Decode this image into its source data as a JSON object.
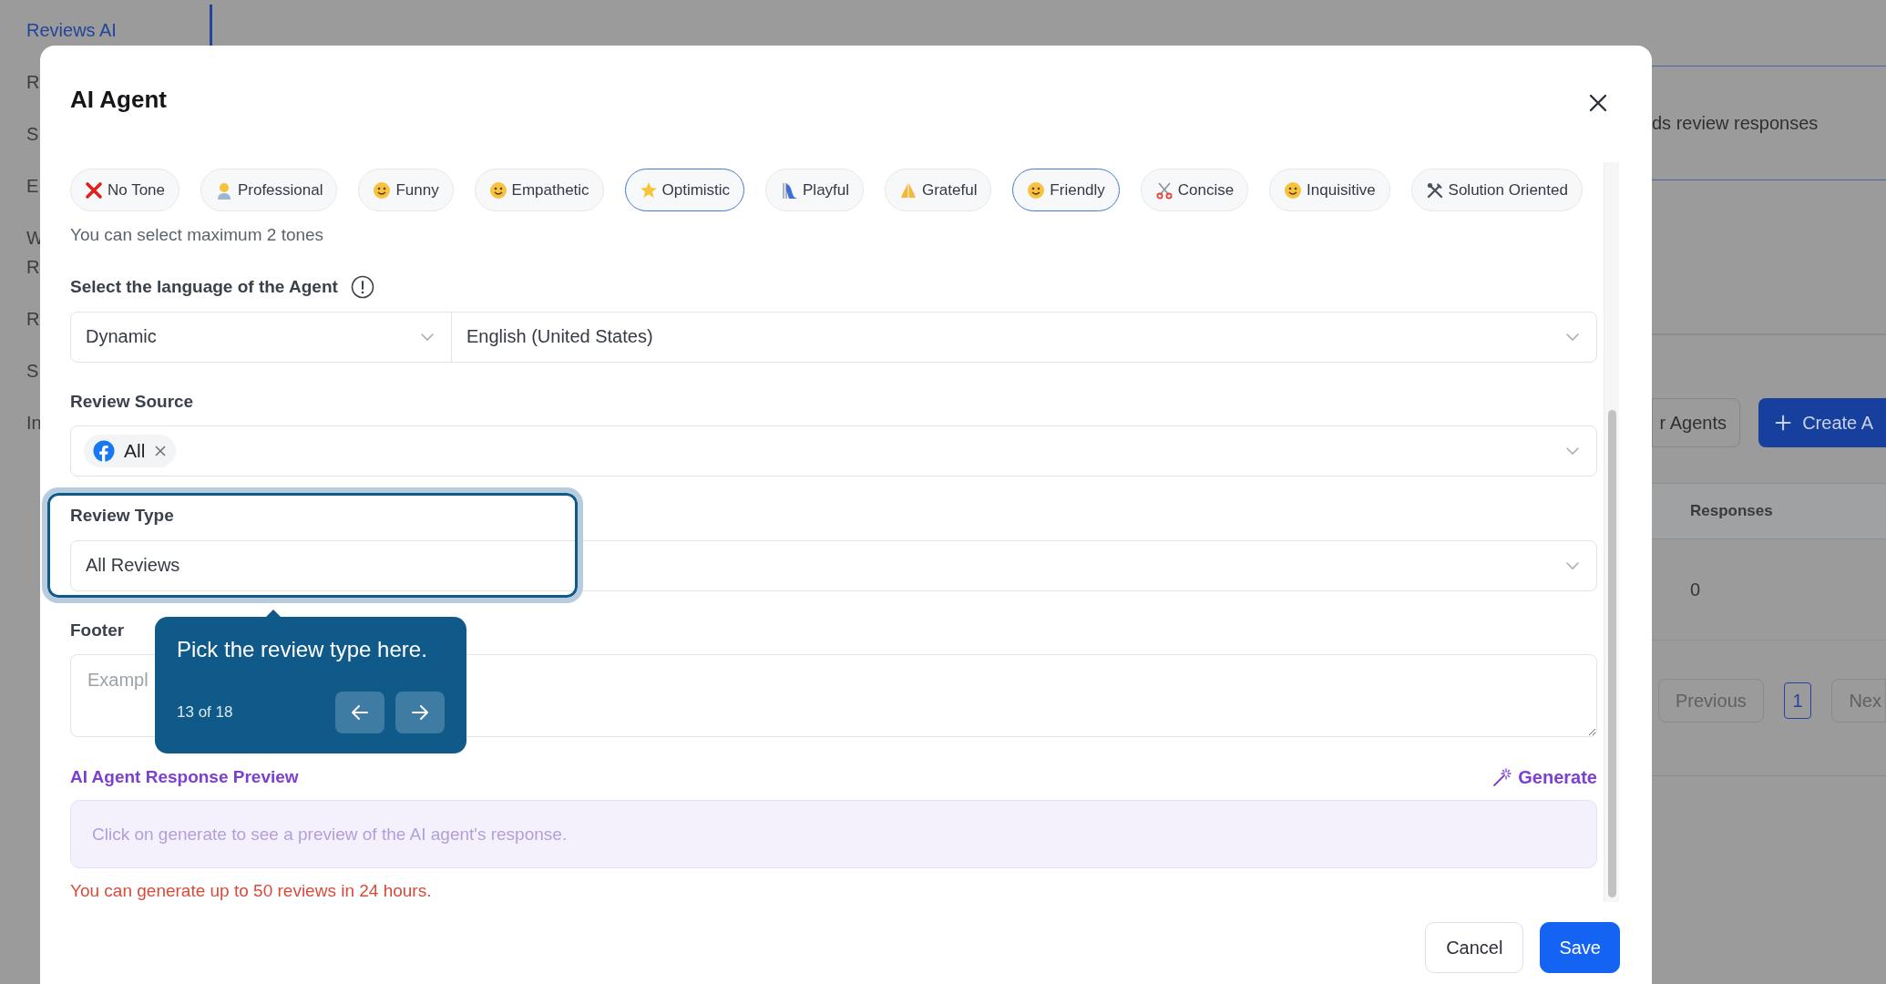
{
  "background": {
    "sidebar": {
      "items": [
        {
          "label": "Reviews AI",
          "selected": true
        },
        {
          "label": "R",
          "selected": false
        },
        {
          "label": "S",
          "selected": false
        },
        {
          "label": "E",
          "selected": false
        },
        {
          "label": "W R",
          "selected": false
        },
        {
          "label": "R",
          "selected": false
        },
        {
          "label": "S",
          "selected": false
        },
        {
          "label": "In",
          "selected": false
        }
      ]
    },
    "subtitle": "ds review responses",
    "buttons": [
      {
        "label": "r Agents",
        "kind": "secondary"
      },
      {
        "label": "Create A",
        "kind": "primary"
      }
    ],
    "table": {
      "columns": [
        "Responses"
      ],
      "rows": [
        [
          "0"
        ]
      ]
    },
    "pagination": {
      "previous": "Previous",
      "pages": [
        {
          "label": "1",
          "selected": true
        }
      ],
      "next": "Nex"
    }
  },
  "modal": {
    "title": "AI Agent",
    "tones": [
      {
        "label": "No Tone",
        "selected": false
      },
      {
        "label": "Professional",
        "selected": false
      },
      {
        "label": "Funny",
        "selected": false
      },
      {
        "label": "Empathetic",
        "selected": false
      },
      {
        "label": "Optimistic",
        "selected": true
      },
      {
        "label": "Playful",
        "selected": false
      },
      {
        "label": "Grateful",
        "selected": false
      },
      {
        "label": "Friendly",
        "selected": true
      },
      {
        "label": "Concise",
        "selected": false
      },
      {
        "label": "Inquisitive",
        "selected": false
      },
      {
        "label": "Solution Oriented",
        "selected": false
      }
    ],
    "tones_hint": "You can select maximum 2 tones",
    "language": {
      "label": "Select the language of the Agent",
      "mode": "Dynamic",
      "value": "English (United States)"
    },
    "review_source": {
      "label": "Review Source",
      "tags": [
        "All"
      ]
    },
    "review_type": {
      "label": "Review Type",
      "value": "All Reviews"
    },
    "footer": {
      "label": "Footer",
      "placeholder": "Exampl"
    },
    "preview": {
      "title": "AI Agent Response Preview",
      "generate": "Generate",
      "text": "Click on generate to see a preview of the AI agent's response.",
      "limit_note": "You can generate up to 50 reviews in 24 hours."
    },
    "buttons": [
      {
        "label": "Cancel",
        "kind": "secondary"
      },
      {
        "label": "Save",
        "kind": "primary"
      }
    ]
  },
  "tour": {
    "text": "Pick the review type here.",
    "step": "13 of 18"
  }
}
